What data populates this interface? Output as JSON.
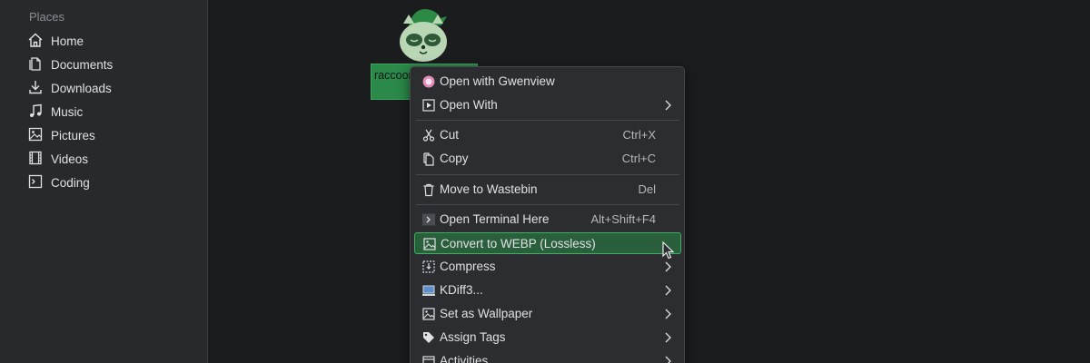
{
  "sidebar": {
    "heading": "Places",
    "items": [
      {
        "label": "Home",
        "icon": "home-icon"
      },
      {
        "label": "Documents",
        "icon": "documents-icon"
      },
      {
        "label": "Downloads",
        "icon": "downloads-icon"
      },
      {
        "label": "Music",
        "icon": "music-icon"
      },
      {
        "label": "Pictures",
        "icon": "pictures-icon"
      },
      {
        "label": "Videos",
        "icon": "videos-icon"
      },
      {
        "label": "Coding",
        "icon": "terminal-icon"
      }
    ]
  },
  "desktop": {
    "file_name": "raccoon",
    "file_icon": "raccoon-thumbnail"
  },
  "context_menu": {
    "items": [
      {
        "label": "Open with Gwenview",
        "shortcut": "",
        "icon": "gwenview-icon",
        "submenu": false
      },
      {
        "label": "Open With",
        "shortcut": "",
        "icon": "open-with-icon",
        "submenu": true
      },
      {
        "label": "Cut",
        "shortcut": "Ctrl+X",
        "icon": "scissors-icon",
        "submenu": false
      },
      {
        "label": "Copy",
        "shortcut": "Ctrl+C",
        "icon": "copy-icon",
        "submenu": false
      },
      {
        "label": "Move to Wastebin",
        "shortcut": "Del",
        "icon": "trash-icon",
        "submenu": false
      },
      {
        "label": "Open Terminal Here",
        "shortcut": "Alt+Shift+F4",
        "icon": "terminal-icon",
        "submenu": false
      },
      {
        "label": "Convert to WEBP (Lossless)",
        "shortcut": "",
        "icon": "image-icon",
        "submenu": false,
        "highlighted": true
      },
      {
        "label": "Compress",
        "shortcut": "",
        "icon": "compress-icon",
        "submenu": true
      },
      {
        "label": "KDiff3...",
        "shortcut": "",
        "icon": "kdiff3-icon",
        "submenu": true
      },
      {
        "label": "Set as Wallpaper",
        "shortcut": "",
        "icon": "wallpaper-icon",
        "submenu": true
      },
      {
        "label": "Assign Tags",
        "shortcut": "",
        "icon": "tag-icon",
        "submenu": true
      },
      {
        "label": "Activities",
        "shortcut": "",
        "icon": "activities-icon",
        "submenu": true
      }
    ]
  },
  "colors": {
    "accent": "#3fae62",
    "highlight_bg": "#2a5f3c",
    "menu_bg": "#2b2d31",
    "sidebar_bg": "#27292c",
    "desktop_bg": "#1b1c1e"
  }
}
